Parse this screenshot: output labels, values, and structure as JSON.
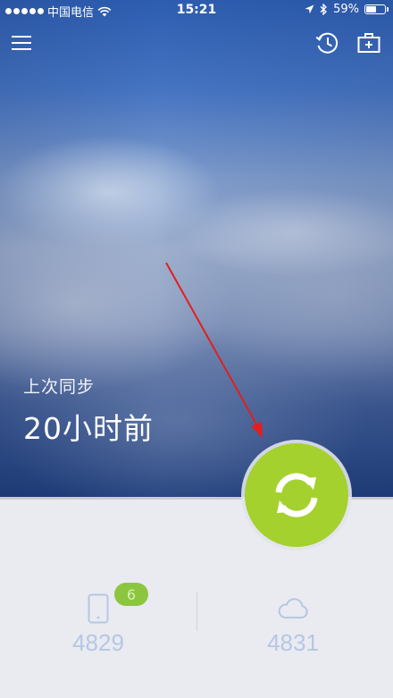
{
  "status_bar": {
    "carrier": "中国电信",
    "time": "15:21",
    "battery": "59%",
    "battery_level": 0.59
  },
  "topbar": {
    "menu_icon": "hamburger-menu-icon",
    "history_icon": "clock-history-icon",
    "toolbox_icon": "medical-kit-icon"
  },
  "sync_info": {
    "label": "上次同步",
    "value": "20小时前"
  },
  "sync_button": {
    "icon": "sync-arrows-icon",
    "color": "#a4d12e"
  },
  "stats": {
    "phone": {
      "icon": "phone-icon",
      "badge": "6",
      "count": "4829"
    },
    "cloud": {
      "icon": "cloud-icon",
      "count": "4831"
    }
  },
  "colors": {
    "accent": "#a4d12e",
    "badge": "#8cc63f",
    "stat_text": "#b7c6e4",
    "annotation_arrow": "#e0201e"
  }
}
